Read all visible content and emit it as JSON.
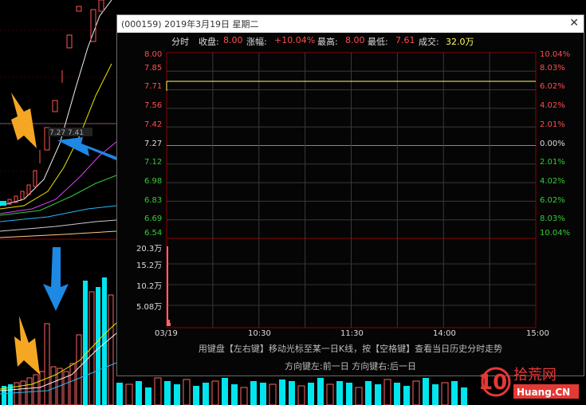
{
  "window": {
    "title": "(000159) 2019年3月19日 星期二",
    "close_glyph": "✕"
  },
  "infobar": {
    "tab": "分时",
    "close_label": "收盘:",
    "close_value": "8.00",
    "change_label": "涨幅:",
    "change_value": "+10.04%",
    "high_label": "最高:",
    "high_value": "8.00",
    "low_label": "最低:",
    "low_value": "7.61",
    "volume_label": "成交:",
    "volume_value": "32.0万"
  },
  "price_axis": {
    "prices": [
      "8.00",
      "7.85",
      "7.71",
      "7.56",
      "7.42",
      "7.27",
      "7.12",
      "6.98",
      "6.83",
      "6.69",
      "6.54"
    ],
    "percents": [
      "10.04%",
      "8.03%",
      "6.02%",
      "4.02%",
      "2.01%",
      "0.00%",
      "2.01%",
      "4.02%",
      "6.02%",
      "8.03%",
      "10.04%"
    ]
  },
  "volume_axis": {
    "labels": [
      "20.3万",
      "15.2万",
      "10.2万",
      "5.08万"
    ]
  },
  "time_axis": {
    "labels": [
      "03/19",
      "10:30",
      "11:30",
      "14:00",
      "15:00"
    ]
  },
  "background_chart": {
    "cursor_label": "7.27 7.41"
  },
  "hint": {
    "line1": "用键盘【左右键】移动光标至某一日K线，按【空格键】查看当日历史分时走势",
    "line2": "方向键左:前一日  方向键右:后一日"
  },
  "watermark": {
    "brand": "拾荒网",
    "number": "10",
    "domain": "Huang.CN"
  },
  "colors": {
    "up": "#ff4d4d",
    "down": "#33cc33",
    "price_line": "#ffff66",
    "volume_bar_up": "#ff6666",
    "volume_bar_cyan": "#00e5ee",
    "arrow_orange": "#f5a623",
    "arrow_blue": "#1e88e5"
  }
}
